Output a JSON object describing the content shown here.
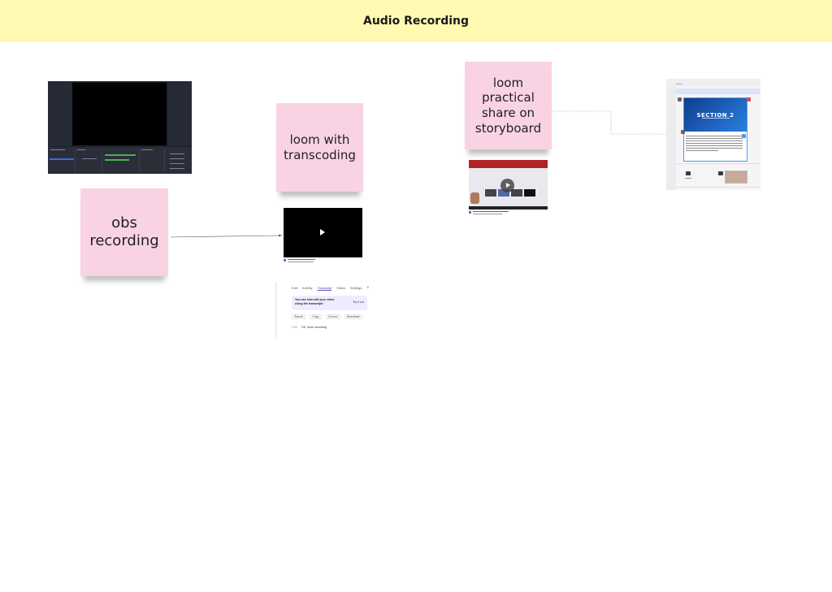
{
  "board": {
    "title": "Audio Recording"
  },
  "stickies": {
    "obs": "obs recording",
    "loom_transcoding": "loom with transcoding",
    "loom_practical": "loom practical share on storyboard"
  },
  "transcript_panel": {
    "tabs": [
      {
        "label": "Edit"
      },
      {
        "label": "Activity"
      },
      {
        "label": "Transcript"
      },
      {
        "label": "Views"
      },
      {
        "label": "Settings"
      }
    ],
    "more": "»",
    "notice": "You can now edit your video using the transcript!",
    "notice_button": "Try it out",
    "actions": [
      {
        "label": "Search"
      },
      {
        "label": "Copy"
      },
      {
        "label": "Correct"
      },
      {
        "label": "Download"
      }
    ],
    "line_time": "0:00",
    "line_text": "OK, done recording."
  },
  "storyboard": {
    "slide_title": "SECTION 2"
  },
  "colors": {
    "banner": "#fff9b1",
    "sticky": "#f9d3e3",
    "accent": "#5a4fcf"
  }
}
